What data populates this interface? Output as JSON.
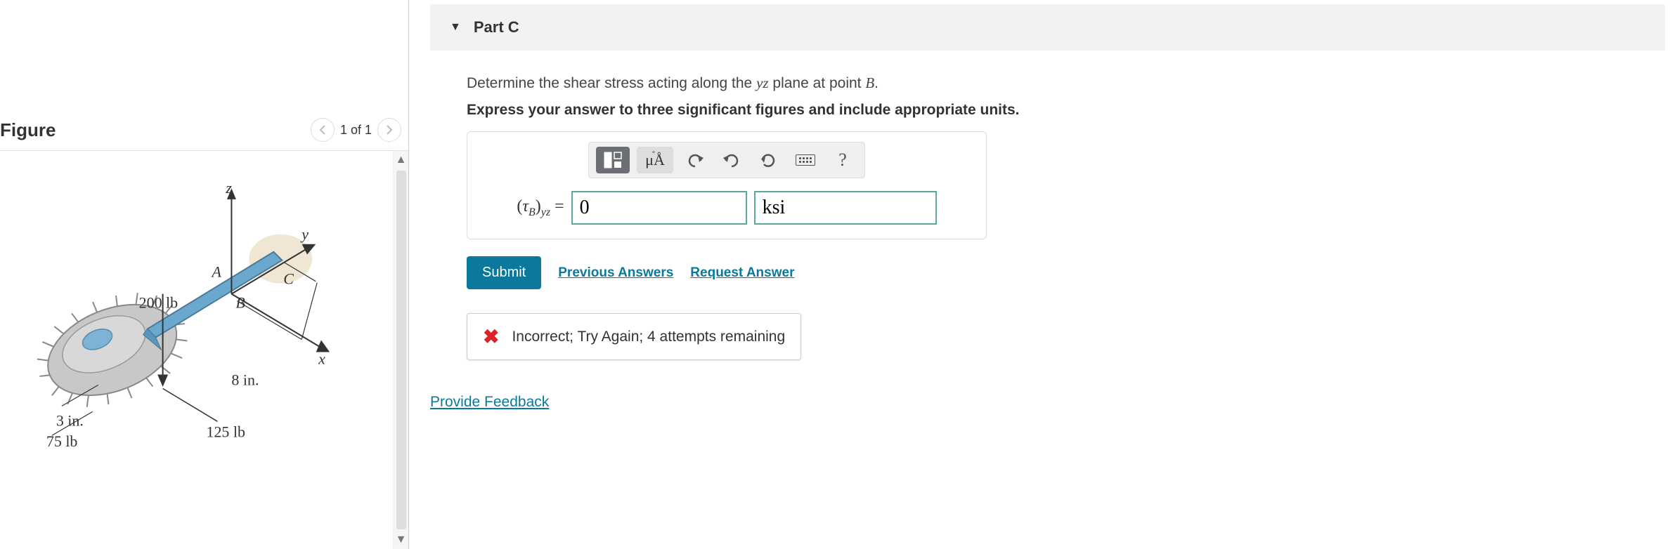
{
  "figure": {
    "title": "Figure",
    "pager_text": "1 of 1",
    "labels": {
      "axis_z": "z",
      "axis_y": "y",
      "axis_x": "x",
      "point_a": "A",
      "point_b": "B",
      "point_c": "C",
      "force_200": "200 lb",
      "force_75": "75 lb",
      "force_125": "125 lb",
      "dim_8in": "8 in.",
      "dim_3in": "3 in."
    }
  },
  "part": {
    "header": "Part C",
    "q_pre": "Determine the shear stress acting along the ",
    "q_plane": "yz",
    "q_mid": " plane at point ",
    "q_point": "B",
    "q_post": ".",
    "hint": "Express your answer to three significant figures and include appropriate units.",
    "var_greek": "τ",
    "var_sub1": "B",
    "var_sub2": "yz",
    "equals": " = ",
    "value": "0",
    "unit": "ksi",
    "units_btn": "μÅ",
    "submit": "Submit",
    "prev": "Previous Answers",
    "request": "Request Answer",
    "feedback": "Incorrect; Try Again; 4 attempts remaining",
    "help": "?",
    "provide_feedback": "Provide Feedback"
  }
}
